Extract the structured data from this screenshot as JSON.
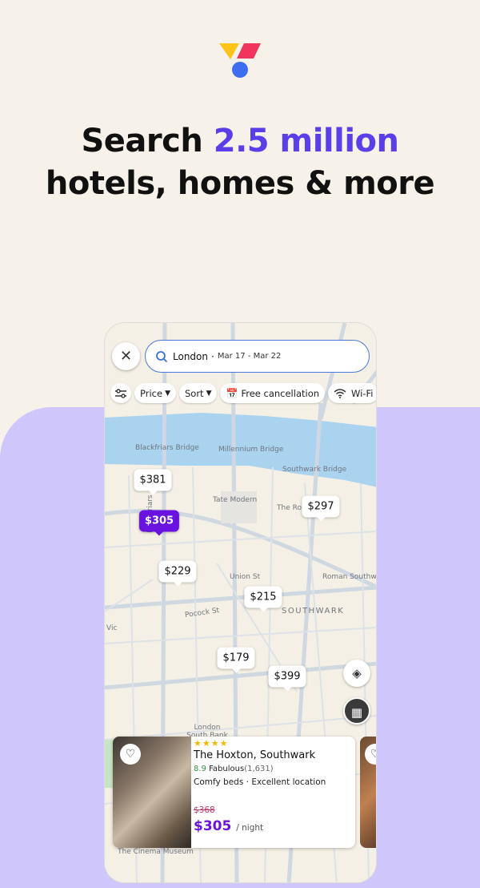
{
  "headline": {
    "line1_prefix": "Search ",
    "line1_highlight": "2.5 million",
    "line2": "hotels, homes & more"
  },
  "colors": {
    "accent": "#5a3ee8",
    "selected_pin": "#6a12e0",
    "purple_bg": "#cfc6fc",
    "beige_bg": "#f6f2ea"
  },
  "logo": {
    "icons": [
      "yellow-triangle",
      "red-parallelogram",
      "blue-circle"
    ]
  },
  "search": {
    "location": "London",
    "separator": "·",
    "dates": "Mar 17 - Mar 22"
  },
  "filters": [
    {
      "label": "Price",
      "icon": "caret-down"
    },
    {
      "label": "Sort",
      "icon": "caret-down"
    },
    {
      "label": "Free cancellation",
      "icon": "calendar-check"
    },
    {
      "label": "Wi-Fi",
      "icon": "wifi"
    }
  ],
  "map": {
    "labels": [
      "Blackfriars Bridge",
      "Millennium Bridge",
      "Southwark Bridge",
      "Tate Modern",
      "The Ro",
      "Union St",
      "Roman Southw",
      "SOUTHWARK",
      "Pocock St",
      "Vic",
      "Blackfriars",
      "London South Bank University",
      "The Cinema Museum"
    ],
    "pins": [
      {
        "price": "$381"
      },
      {
        "price": "$305",
        "selected": true
      },
      {
        "price": "$229"
      },
      {
        "price": "$215"
      },
      {
        "price": "$297"
      },
      {
        "price": "$179"
      },
      {
        "price": "$399"
      }
    ]
  },
  "hotel_card": {
    "stars": 4,
    "stars_text": "★★★★",
    "name": "The Hoxton, Southwark",
    "score": "8.9",
    "score_label": "Fabulous",
    "review_count": "(1,631)",
    "tags": "Comfy beds · Excellent location",
    "old_price": "$368",
    "price": "$305",
    "per": "/ night"
  }
}
